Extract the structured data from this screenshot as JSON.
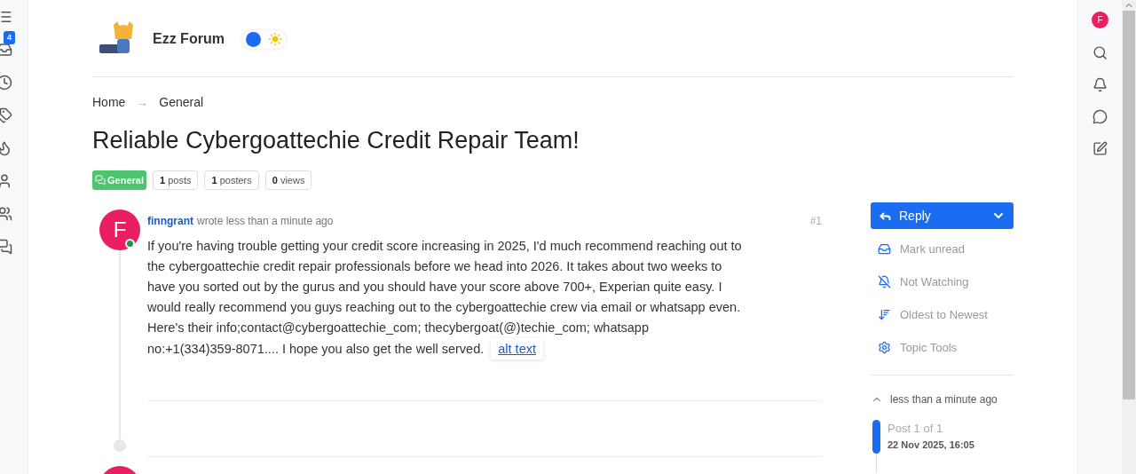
{
  "left_sidebar": {
    "unread_badge": "4"
  },
  "header": {
    "site_title": "Ezz Forum",
    "theme_toggle": {
      "on": false
    }
  },
  "breadcrumb": [
    "Home",
    "General"
  ],
  "breadcrumb_separator": "→",
  "topic": {
    "title": "Reliable Cybergoattechie Credit Repair Team!",
    "category": "General",
    "stats": [
      {
        "count": "1",
        "label": "posts"
      },
      {
        "count": "1",
        "label": "posters"
      },
      {
        "count": "0",
        "label": "views"
      }
    ]
  },
  "post": {
    "avatar_letter": "F",
    "online": true,
    "author": "finngrant",
    "meta": "wrote less than a minute ago",
    "number": "#1",
    "body_lines": [
      "If you're having trouble getting your credit score increasing in 2025, I'd much recommend reaching out to",
      "the cybergoattechie credit repair professionals before we head into 2026. It takes about two weeks to",
      "have you sorted out by the gurus and you should have your score above 700+, Experian quite easy. I",
      "would really recommend you guys reaching out to the cybergoattechie crew via email or whatsapp even.",
      "Here's their info;contact@cybergoattechie_com; thecybergoat(@)techie_com; whatsapp",
      "no:+1(334)359-8071.... I hope you also get the well served."
    ],
    "alt_text_link": "alt text"
  },
  "actions": {
    "reply": "Reply",
    "items": [
      {
        "kind": "mark-unread",
        "label": "Mark unread"
      },
      {
        "kind": "watching",
        "label": "Not Watching"
      },
      {
        "kind": "sort",
        "label": "Oldest to Newest"
      },
      {
        "kind": "tools",
        "label": "Topic Tools"
      }
    ]
  },
  "timeline": {
    "top_label": "less than a minute ago",
    "position": "Post 1 of 1",
    "date": "22 Nov 2025, 16:05",
    "level": 1
  },
  "right_sidebar": {
    "avatar_letter": "F"
  }
}
